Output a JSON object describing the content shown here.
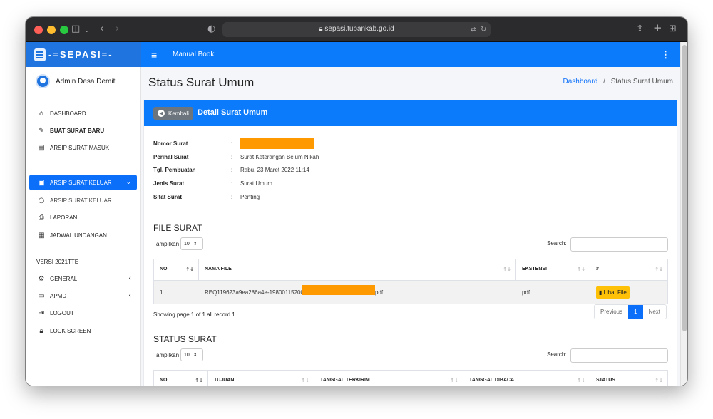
{
  "browser": {
    "url": "sepasi.tubankab.go.id",
    "icons": [
      "sidebar-icon",
      "chevron-left-icon",
      "chevron-right-icon",
      "shield-icon",
      "lock-icon",
      "translate-icon",
      "reload-icon",
      "share-icon",
      "plus-icon",
      "tabs-grid-icon"
    ]
  },
  "brand": {
    "name": "-=SEPASI=-"
  },
  "topnav": {
    "menu_label": "Manual Book"
  },
  "user": {
    "name": "Admin Desa Demit"
  },
  "sidebar": {
    "items": [
      {
        "label": "DASHBOARD",
        "icon": "home-icon"
      },
      {
        "label": "BUAT SURAT BARU",
        "icon": "pen-icon"
      },
      {
        "label": "ARSIP SURAT MASUK",
        "icon": "inbox-icon"
      },
      {
        "label": "ARSIP SURAT KELUAR",
        "icon": "outbox-icon",
        "active": true
      },
      {
        "label": "ARSIP SURAT KELUAR",
        "icon": "circle-icon"
      },
      {
        "label": "LAPORAN",
        "icon": "print-icon"
      },
      {
        "label": "JADWAL UNDANGAN",
        "icon": "calendar-icon"
      }
    ],
    "version": "VERSI 2021TTE",
    "items2": [
      {
        "label": "GENERAL",
        "icon": "gear-icon"
      },
      {
        "label": "APMD",
        "icon": "id-card-icon"
      },
      {
        "label": "LOGOUT",
        "icon": "logout-icon"
      },
      {
        "label": "LOCK SCREEN",
        "icon": "lock-icon"
      }
    ]
  },
  "page": {
    "title": "Status Surat Umum",
    "breadcrumb_link": "Dashboard",
    "breadcrumb_sep": "/",
    "breadcrumb_current": "Status Surat Umum"
  },
  "card": {
    "back_label": "Kembali",
    "title": "Detail Surat Umum"
  },
  "detail": {
    "rows": [
      {
        "key": "Nomor Surat",
        "value": ""
      },
      {
        "key": "Perihal Surat",
        "value": "Surat Keterangan Belum Nikah"
      },
      {
        "key": "Tgl. Pembuatan",
        "value": "Rabu, 23 Maret 2022 11:14"
      },
      {
        "key": "Jenis Surat",
        "value": "Surat Umum"
      },
      {
        "key": "Sifat Surat",
        "value": "Penting"
      }
    ],
    "colon": ":"
  },
  "file_section": {
    "title": "FILE SURAT",
    "length_label": "Tampilkan",
    "length_value": "10",
    "search_label": "Search:",
    "columns": [
      "NO",
      "NAMA FILE",
      "EKSTENSI",
      "#"
    ],
    "rows": [
      {
        "no": "1",
        "name_prefix": "REQ119623a9ea286a4e-198001152008",
        "name_suffix": "pdf",
        "ext": "pdf",
        "action": "Lihat File"
      }
    ],
    "info": "Showing page 1 of 1 all record 1",
    "pager": {
      "prev": "Previous",
      "page": "1",
      "next": "Next"
    }
  },
  "status_section": {
    "title": "STATUS SURAT",
    "length_label": "Tampilkan",
    "length_value": "10",
    "search_label": "Search:",
    "columns": [
      "NO",
      "TUJUAN",
      "TANGGAL TERKIRIM",
      "TANGGAL DIBACA",
      "STATUS"
    ]
  },
  "colors": {
    "primary": "#0b7bfb",
    "active": "#0b6ffa",
    "redaction": "#ff9900",
    "warning": "#ffc107"
  }
}
